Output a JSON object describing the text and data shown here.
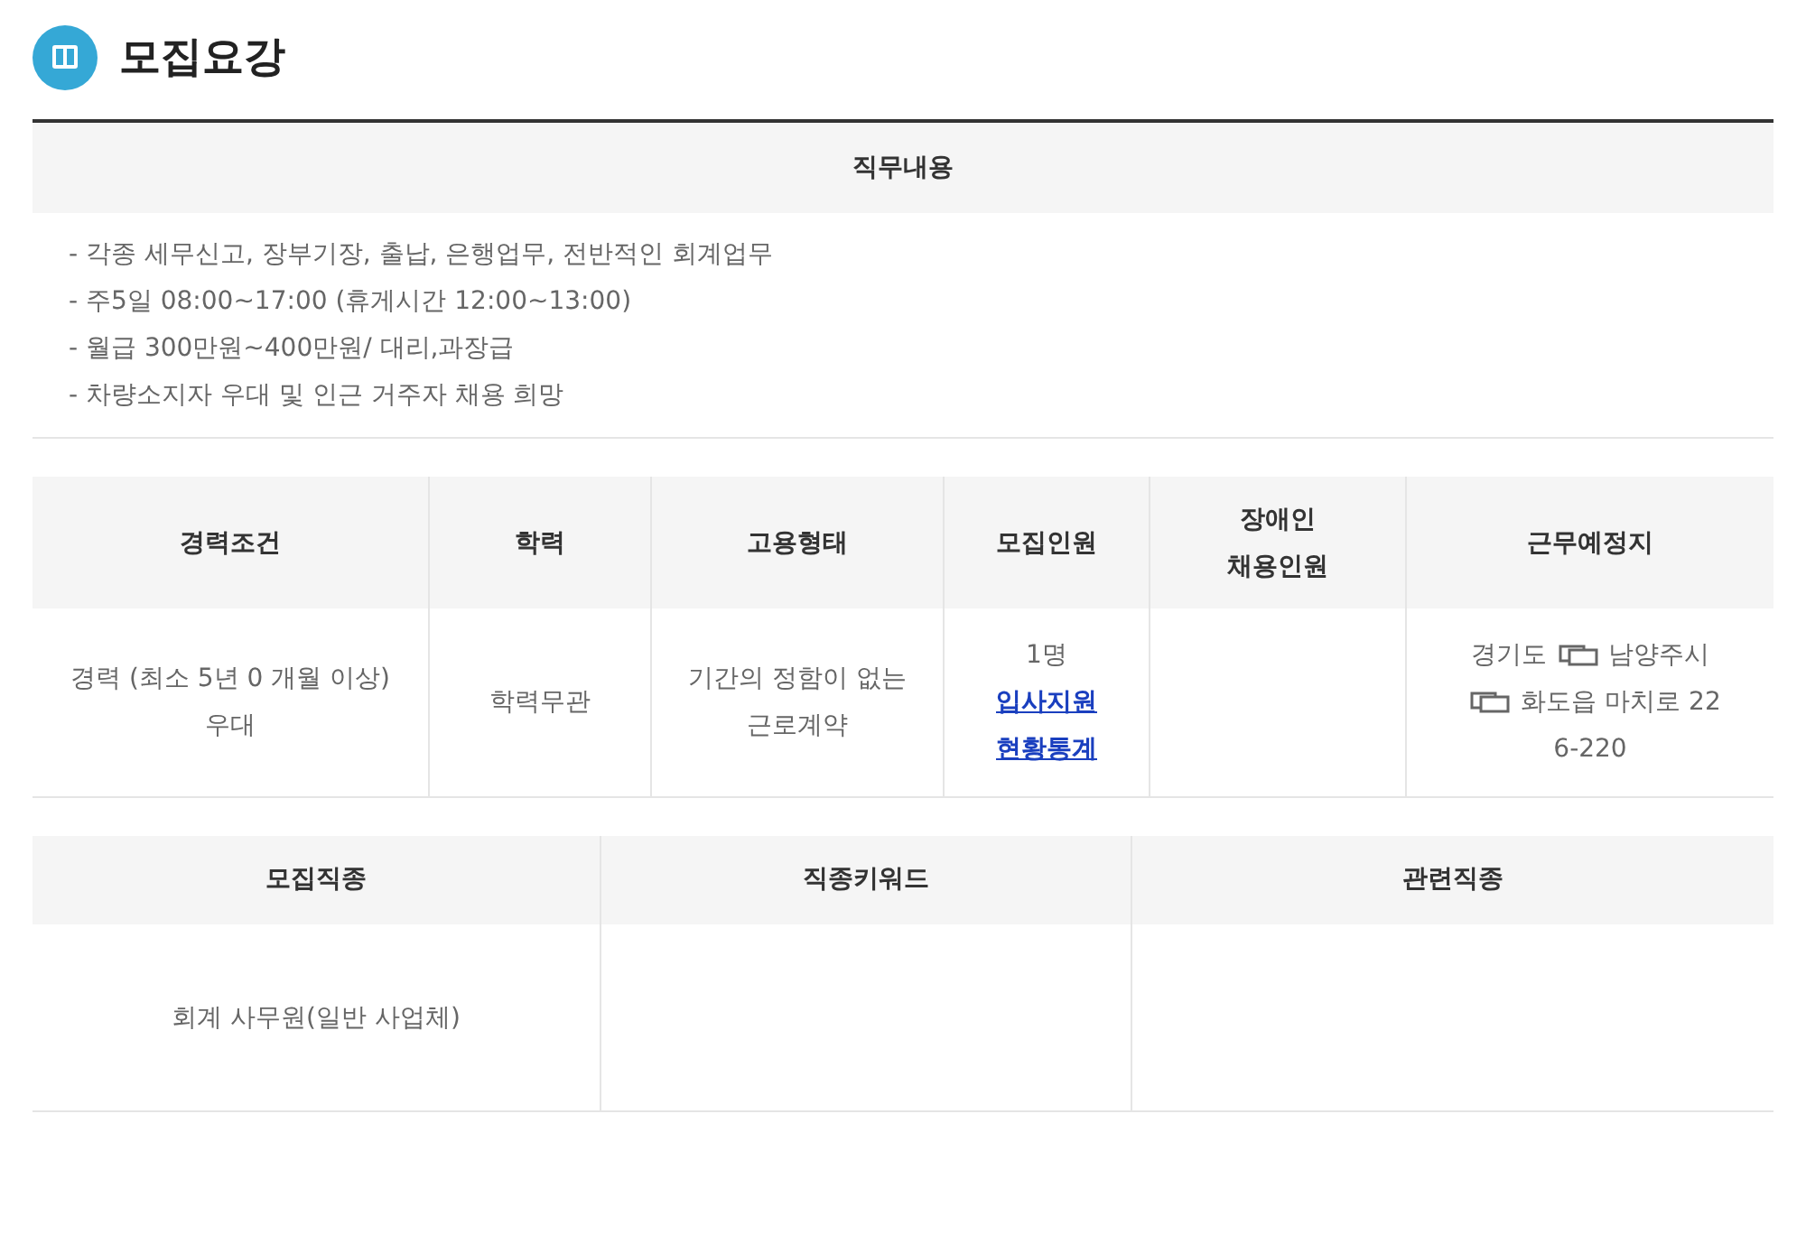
{
  "title": "모집요강",
  "duty": {
    "heading": "직무내용",
    "lines": [
      "- 각종 세무신고, 장부기장, 출납, 은행업무, 전반적인 회계업무",
      "- 주5일 08:00~17:00 (휴게시간 12:00~13:00)",
      "- 월급 300만원~400만원/ 대리,과장급",
      "- 차량소지자 우대 및 인근 거주자 채용 희망"
    ]
  },
  "conditions": {
    "columns": [
      "경력조건",
      "학력",
      "고용형태",
      "모집인원",
      "장애인\n채용인원",
      "근무예정지"
    ],
    "career": [
      "경력 (최소 5년 0 개월 이상)",
      "우대"
    ],
    "education": "학력무관",
    "employment": "기간의 정함이 없는\n근로계약",
    "headcount": "1명",
    "links": [
      "입사지원",
      "현황통계"
    ],
    "location": [
      "경기도",
      "남양주시",
      "화도읍 마치로 226-220"
    ]
  },
  "jobs": {
    "columns": [
      "모집직종",
      "직종키워드",
      "관련직종"
    ],
    "cells": [
      "회계 사무원(일반 사업체)",
      null,
      null
    ]
  }
}
